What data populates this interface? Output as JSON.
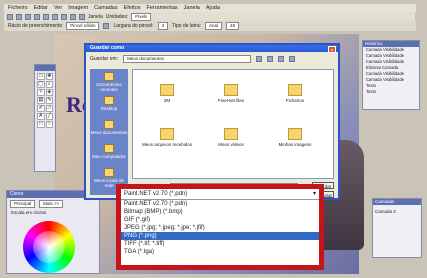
{
  "menu": [
    "Ficheiro",
    "Editar",
    "Ver",
    "Imagem",
    "Camadas",
    "Efeitos",
    "Ferramentas",
    "Janela",
    "Ajuda"
  ],
  "toolbar": {
    "zoom_label": "Janela",
    "units_label": "Unidades:",
    "units_value": "Pixels"
  },
  "toolbar2": {
    "brush_label": "Rácio de preenchimento",
    "antialias_label": "Pincel sólido",
    "width_label": "Largura do pincel:",
    "width_value": "3",
    "font_label": "Tipo de letra:",
    "font_value": "Arial",
    "size_value": "48"
  },
  "canvas_text": "Rev",
  "history": {
    "title": "Histórico",
    "items": [
      "Camada Visibilidade",
      "Camada Visibilidade",
      "Camada Visibilidade",
      "Eliminar Camada",
      "Camada Visibilidade",
      "Camada Visibilidade",
      "Texto",
      "Texto"
    ]
  },
  "colors": {
    "title": "Cores",
    "mode": "Principal",
    "more": "Mais >>",
    "mode_label": "Escala em cinzas"
  },
  "layers": {
    "title": "Camadas",
    "item": "Camada 2"
  },
  "dialog": {
    "title": "Guardar como",
    "save_in_label": "Guardar em:",
    "save_in_value": "Meus documentos",
    "places": [
      "Documentos recentes",
      "Desktop",
      "Meus documentos",
      "Meu computador",
      "Meus locais de rede"
    ],
    "files": [
      {
        "name": "3M"
      },
      {
        "name": "FineHott files"
      },
      {
        "name": "Ficheiros"
      },
      {
        "name": "Meus arquivos recebidos"
      },
      {
        "name": "Meus vídeos"
      },
      {
        "name": "Minhas imagens"
      }
    ],
    "name_label": "Nome do ficheiro:",
    "save_button": "Guardar",
    "cancel_button": "Cancelar"
  },
  "file_types": {
    "selected": "Paint.NET v2.70 (*.pdn)",
    "options": [
      "Paint.NET v2.70 (*.pdn)",
      "Bitmap (BMP) (*.bmp)",
      "GIF (*.gif)",
      "JPEG (*.jpg; *.jpeg; *.jpe; *.jfif)",
      "PNG (*.png)",
      "TIFF (*.tif; *.tiff)",
      "TGA (*.tga)"
    ],
    "highlighted_index": 4
  }
}
